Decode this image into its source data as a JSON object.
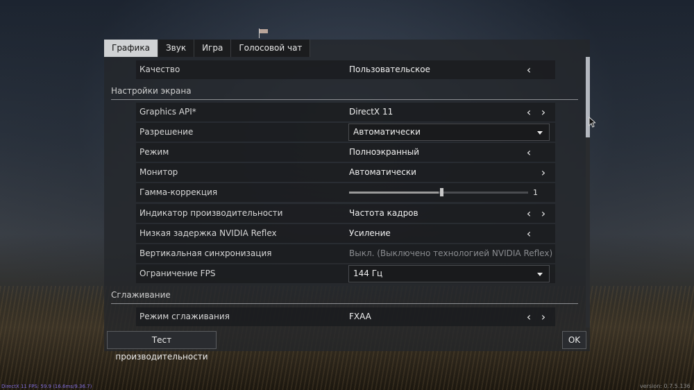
{
  "tabs": [
    {
      "label": "Графика",
      "active": true
    },
    {
      "label": "Звук",
      "active": false
    },
    {
      "label": "Игра",
      "active": false
    },
    {
      "label": "Голосовой чат",
      "active": false
    }
  ],
  "quality": {
    "label": "Качество",
    "value": "Пользовательское"
  },
  "sections": {
    "screen": "Настройки экрана",
    "antialiasing": "Сглаживание"
  },
  "screen_settings": {
    "graphics_api": {
      "label": "Graphics API*",
      "value": "DirectX 11"
    },
    "resolution": {
      "label": "Разрешение",
      "value": "Автоматически"
    },
    "mode": {
      "label": "Режим",
      "value": "Полноэкранный"
    },
    "monitor": {
      "label": "Монитор",
      "value": "Автоматически"
    },
    "gamma": {
      "label": "Гамма-коррекция",
      "value": "1",
      "fraction": 0.5
    },
    "perf_indicator": {
      "label": "Индикатор производительности",
      "value": "Частота кадров"
    },
    "reflex": {
      "label": "Низкая задержка NVIDIA Reflex",
      "value": "Усиление"
    },
    "vsync": {
      "label": "Вертикальная синхронизация",
      "value": "Выкл. (Выключено технологией NVIDIA Reflex)"
    },
    "fps_limit": {
      "label": "Ограничение FPS",
      "value": "144 Гц"
    }
  },
  "aa_settings": {
    "aa_mode": {
      "label": "Режим сглаживания",
      "value": "FXAA"
    }
  },
  "footer": {
    "perf_test": "Тест производительности",
    "ok": "OK"
  },
  "status": {
    "left": "DirectX 11 FPS: 59.9 (16.6ms/9.36.7)",
    "right": "version: 0.7.5.136"
  },
  "icons": {
    "left": "chevron-left-icon",
    "right": "chevron-right-icon",
    "dropdown": "caret-down-icon"
  }
}
